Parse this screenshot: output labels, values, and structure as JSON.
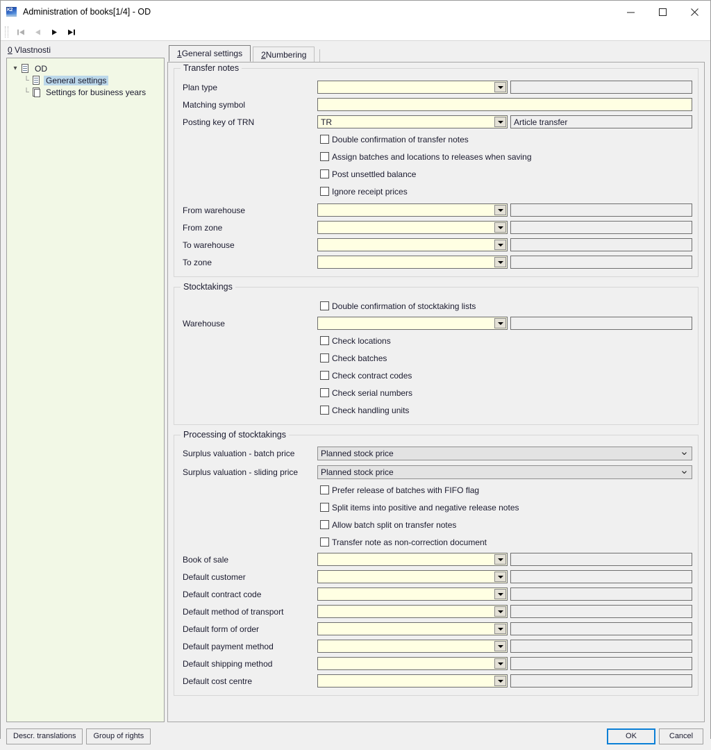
{
  "window": {
    "title": "Administration of books[1/4] - OD",
    "icon": "k2-app-icon",
    "minimize": "minimize-icon",
    "maximize": "maximize-icon",
    "close": "close-icon"
  },
  "toolbar": {
    "first": "first-record-icon",
    "prev": "previous-record-icon",
    "next": "next-record-icon",
    "last": "last-record-icon"
  },
  "left": {
    "label_prefix": "0",
    "label_text": " Vlastnosti",
    "tree": [
      {
        "label": "OD",
        "level": 0,
        "selected": false,
        "icon": "document-icon",
        "expander": "⌄"
      },
      {
        "label": "General settings",
        "level": 1,
        "selected": true,
        "icon": "document-icon"
      },
      {
        "label": "Settings for business years",
        "level": 1,
        "selected": false,
        "icon": "documents-icon"
      }
    ]
  },
  "tabs": [
    {
      "num": "1",
      "label": " General settings",
      "active": true
    },
    {
      "num": "2",
      "label": " Numbering",
      "active": false
    }
  ],
  "groups": {
    "transfer_notes": {
      "title": "Transfer notes",
      "fields": [
        {
          "label": "Plan type",
          "value": "",
          "side": "",
          "type": "lookup"
        },
        {
          "label": "Matching symbol",
          "value": "",
          "type": "text"
        },
        {
          "label": "Posting key of TRN",
          "value": "TR",
          "side": "Article transfer",
          "type": "lookup"
        }
      ],
      "checkboxes": [
        {
          "label": "Double confirmation of transfer notes",
          "checked": false
        },
        {
          "label": "Assign batches and locations to releases when saving",
          "checked": false
        },
        {
          "label": "Post unsettled balance",
          "checked": false
        },
        {
          "label": "Ignore receipt prices",
          "checked": false
        }
      ],
      "fields2": [
        {
          "label": "From warehouse",
          "value": "",
          "side": "",
          "type": "lookup"
        },
        {
          "label": "From zone",
          "value": "",
          "side": "",
          "type": "lookup"
        },
        {
          "label": "To warehouse",
          "value": "",
          "side": "",
          "type": "lookup"
        },
        {
          "label": "To zone",
          "value": "",
          "side": "",
          "type": "lookup"
        }
      ]
    },
    "stocktakings": {
      "title": "Stocktakings",
      "top_checkbox": {
        "label": "Double confirmation of stocktaking lists",
        "checked": false
      },
      "warehouse": {
        "label": "Warehouse",
        "value": "",
        "side": "",
        "type": "lookup"
      },
      "checkboxes": [
        {
          "label": "Check locations",
          "checked": false
        },
        {
          "label": "Check batches",
          "checked": false
        },
        {
          "label": "Check contract codes",
          "checked": false
        },
        {
          "label": "Check serial numbers",
          "checked": false
        },
        {
          "label": "Check handling units",
          "checked": false
        }
      ]
    },
    "processing": {
      "title": "Processing of stocktakings",
      "combos": [
        {
          "label": "Surplus valuation - batch price",
          "value": "Planned stock price"
        },
        {
          "label": "Surplus valuation - sliding price",
          "value": "Planned stock price"
        }
      ],
      "checkboxes": [
        {
          "label": "Prefer release of batches with FIFO flag",
          "checked": false
        },
        {
          "label": "Split items into positive and negative release notes",
          "checked": false
        },
        {
          "label": "Allow batch split on transfer notes",
          "checked": false
        },
        {
          "label": "Transfer note as non-correction document",
          "checked": false
        }
      ],
      "fields": [
        {
          "label": "Book of sale",
          "value": "",
          "side": "",
          "type": "lookup"
        },
        {
          "label": "Default customer",
          "value": "",
          "side": "",
          "type": "lookup"
        },
        {
          "label": "Default contract code",
          "value": "",
          "side": "",
          "type": "lookup"
        },
        {
          "label": "Default method of transport",
          "value": "",
          "side": "",
          "type": "lookup"
        },
        {
          "label": "Default form of order",
          "value": "",
          "side": "",
          "type": "lookup"
        },
        {
          "label": "Default payment method",
          "value": "",
          "side": "",
          "type": "lookup"
        },
        {
          "label": "Default shipping method",
          "value": "",
          "side": "",
          "type": "lookup"
        },
        {
          "label": "Default cost centre",
          "value": "",
          "side": "",
          "type": "lookup"
        }
      ]
    }
  },
  "footer": {
    "descr_translations": "Descr. translations",
    "group_of_rights": "Group of rights",
    "ok": "OK",
    "cancel": "Cancel"
  },
  "colors": {
    "editable_field": "#ffffe3",
    "readonly_field": "#efefef",
    "tree_background": "#f2f8e6",
    "selection": "#bcd8ea",
    "focus_border": "#0a7fd6",
    "window_background": "#f0f0f0"
  }
}
